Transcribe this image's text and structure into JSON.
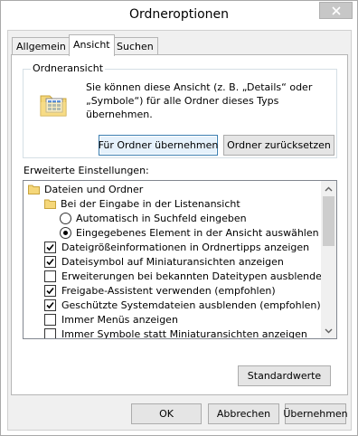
{
  "window": {
    "title": "Ordneroptionen"
  },
  "tabs": [
    {
      "label": "Allgemein",
      "active": false
    },
    {
      "label": "Ansicht",
      "active": true
    },
    {
      "label": "Suchen",
      "active": false
    }
  ],
  "folder_view": {
    "legend": "Ordneransicht",
    "description": "Sie können diese Ansicht (z. B. „Details“ oder „Symbole“) für alle Ordner dieses Typs übernehmen.",
    "apply_button": "Für Ordner übernehmen",
    "reset_button": "Ordner zurücksetzen"
  },
  "advanced": {
    "label": "Erweiterte Einstellungen:",
    "items": [
      {
        "label": "Dateien und Ordner",
        "kind": "folder",
        "checked": null
      },
      {
        "label": "Bei der Eingabe in der Listenansicht",
        "kind": "folder",
        "checked": null
      },
      {
        "label": "Automatisch in Suchfeld eingeben",
        "kind": "radio",
        "checked": false
      },
      {
        "label": "Eingegebenes Element in der Ansicht auswählen",
        "kind": "radio",
        "checked": true
      },
      {
        "label": "Dateigrößeinformationen in Ordnertipps anzeigen",
        "kind": "checkbox",
        "checked": true
      },
      {
        "label": "Dateisymbol auf Miniaturansichten anzeigen",
        "kind": "checkbox",
        "checked": true
      },
      {
        "label": "Erweiterungen bei bekannten Dateitypen ausblenden",
        "kind": "checkbox",
        "checked": false
      },
      {
        "label": "Freigabe-Assistent verwenden (empfohlen)",
        "kind": "checkbox",
        "checked": true
      },
      {
        "label": "Geschützte Systemdateien ausblenden (empfohlen)",
        "kind": "checkbox",
        "checked": true
      },
      {
        "label": "Immer Menüs anzeigen",
        "kind": "checkbox",
        "checked": false
      },
      {
        "label": "Immer Symbole statt Miniaturansichten anzeigen",
        "kind": "checkbox",
        "checked": false
      }
    ],
    "defaults_button": "Standardwerte"
  },
  "footer": {
    "ok": "OK",
    "cancel": "Abbrechen",
    "apply": "Übernehmen"
  },
  "colors": {
    "close_button": "#c7c7c7",
    "dialog_bg": "#f0f0f0",
    "focus_border": "#3c7fb1"
  }
}
